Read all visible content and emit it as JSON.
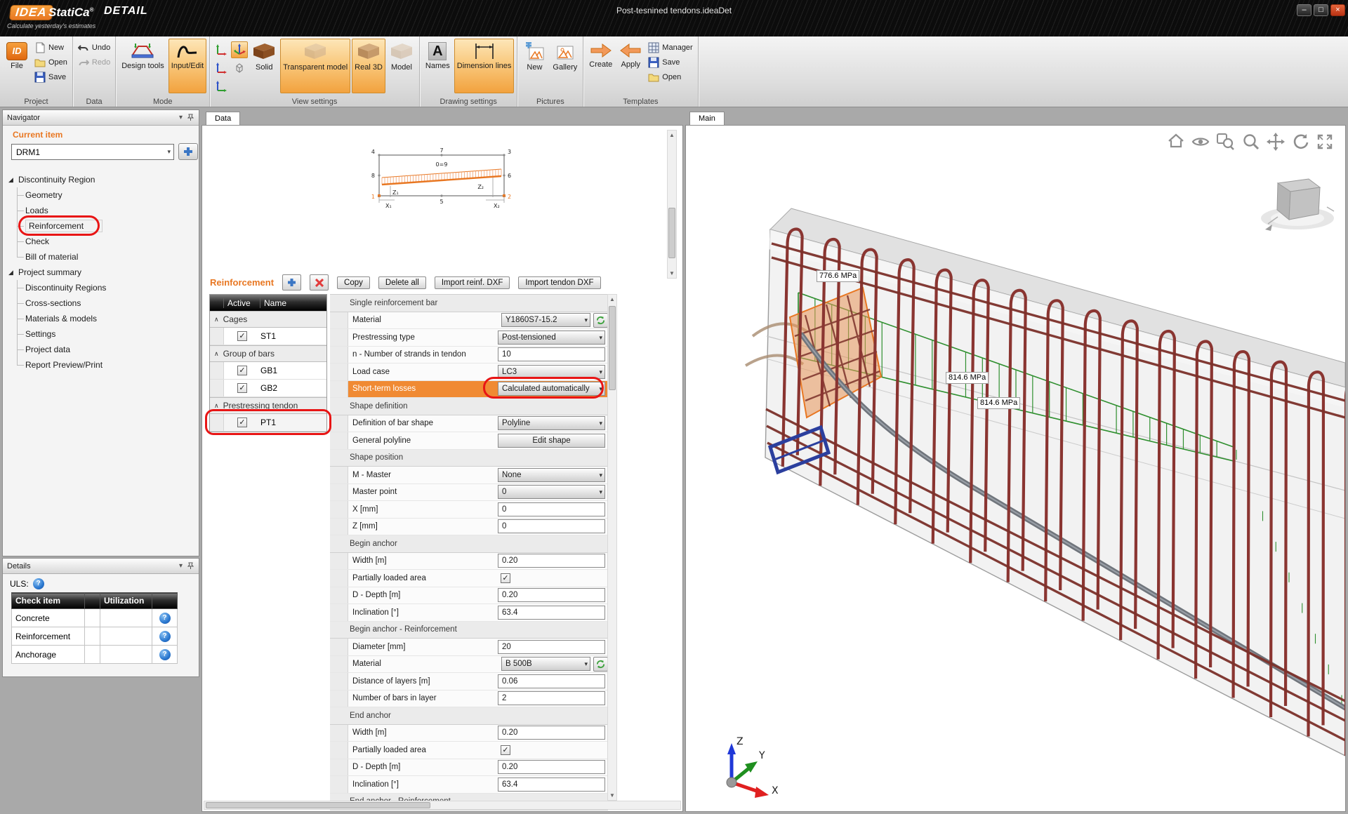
{
  "colors": {
    "accent": "#e87722",
    "annotation": "#e81515",
    "rebar": "#8a3531",
    "rebar_dark": "#6e2a24",
    "tendon": "#70757c",
    "stress_green": "#2f8f2f",
    "selected_row": "#f08a33",
    "concrete": "#e4e4e4"
  },
  "titlebar": {
    "brand": "IDEA",
    "brand2": "StatiCa",
    "reg": "®",
    "product": "DETAIL",
    "tagline": "Calculate yesterday's estimates",
    "document": "Post-tesnined tendons.ideaDet"
  },
  "ribbon": {
    "groups": [
      "Project",
      "Data",
      "Mode",
      "View settings",
      "Drawing settings",
      "Pictures",
      "Templates"
    ],
    "file": "File",
    "new": "New",
    "open": "Open",
    "save": "Save",
    "undo": "Undo",
    "redo": "Redo",
    "design_tools": "Design tools",
    "input_edit": "Input/Edit",
    "solid": "Solid",
    "transparent": "Transparent model",
    "real3d": "Real 3D",
    "model": "Model",
    "names": "Names",
    "dimlines": "Dimension lines",
    "pic_new": "New",
    "gallery": "Gallery",
    "create": "Create",
    "apply": "Apply",
    "manager": "Manager",
    "tsave": "Save",
    "topen": "Open"
  },
  "navigator": {
    "header": "Navigator",
    "current_item_label": "Current item",
    "current_item_value": "DRM1",
    "tree": [
      {
        "label": "Discontinuity Region"
      },
      {
        "label": "Geometry"
      },
      {
        "label": "Loads"
      },
      {
        "label": "Reinforcement"
      },
      {
        "label": "Check"
      },
      {
        "label": "Bill of material"
      },
      {
        "label": "Project summary"
      },
      {
        "label": "Discontinuity Regions"
      },
      {
        "label": "Cross-sections"
      },
      {
        "label": "Materials & models"
      },
      {
        "label": "Settings"
      },
      {
        "label": "Project data"
      },
      {
        "label": "Report Preview/Print"
      }
    ]
  },
  "details": {
    "header": "Details",
    "uls_label": "ULS:",
    "columns": [
      "Check item",
      "",
      "Utilization",
      ""
    ],
    "rows": [
      "Concrete",
      "Reinforcement",
      "Anchorage"
    ]
  },
  "data_panel": {
    "tab": "Data",
    "diagram": {
      "p1": "1",
      "p2": "2",
      "p3": "3",
      "p4": "4",
      "p5": "5",
      "p6": "6",
      "p7": "7",
      "p8": "8",
      "d": "0=9",
      "z1": "Z₁",
      "z2": "Z₂",
      "x1": "X₁",
      "x2": "X₂"
    }
  },
  "reinforcement": {
    "title": "Reinforcement",
    "buttons": {
      "copy": "Copy",
      "delete_all": "Delete all",
      "import_reinf": "Import reinf. DXF",
      "import_tendon": "Import tendon DXF"
    },
    "table": {
      "col_active": "Active",
      "col_name": "Name",
      "groups": [
        {
          "label": "Cages",
          "items": [
            "ST1"
          ]
        },
        {
          "label": "Group of bars",
          "items": [
            "GB1",
            "GB2"
          ]
        },
        {
          "label": "Prestressing tendon",
          "items": [
            "PT1"
          ]
        }
      ]
    }
  },
  "properties": {
    "rows": [
      {
        "t": "sec",
        "label": "Single reinforcement bar"
      },
      {
        "t": "dd",
        "label": "Material",
        "value": "Y1860S7-15.2"
      },
      {
        "t": "dd",
        "label": "Prestressing type",
        "value": "Post-tensioned"
      },
      {
        "t": "in",
        "label": "n - Number of strands in tendon",
        "value": "10"
      },
      {
        "t": "dd",
        "label": "Load case",
        "value": "LC3"
      },
      {
        "t": "dd",
        "label": "Short-term losses",
        "value": "Calculated automatically"
      },
      {
        "t": "sec",
        "label": "Shape definition"
      },
      {
        "t": "dd",
        "label": "Definition of bar shape",
        "value": "Polyline"
      },
      {
        "t": "btn",
        "label": "General polyline",
        "value": "Edit shape"
      },
      {
        "t": "sec",
        "label": "Shape position"
      },
      {
        "t": "dd",
        "label": "M - Master",
        "value": "None"
      },
      {
        "t": "dd",
        "label": "Master point",
        "value": "0"
      },
      {
        "t": "in",
        "label": "X [mm]",
        "value": "0"
      },
      {
        "t": "in",
        "label": "Z [mm]",
        "value": "0"
      },
      {
        "t": "sec",
        "label": "Begin anchor"
      },
      {
        "t": "in",
        "label": "Width [m]",
        "value": "0.20"
      },
      {
        "t": "chk",
        "label": "Partially loaded area",
        "value": "checked"
      },
      {
        "t": "in",
        "label": "D - Depth [m]",
        "value": "0.20"
      },
      {
        "t": "in",
        "label": "Inclination [°]",
        "value": "63.4"
      },
      {
        "t": "sec",
        "label": "Begin anchor - Reinforcement"
      },
      {
        "t": "in",
        "label": "Diameter [mm]",
        "value": "20"
      },
      {
        "t": "dd",
        "label": "Material",
        "value": "B 500B"
      },
      {
        "t": "in",
        "label": "Distance of layers [m]",
        "value": "0.06"
      },
      {
        "t": "in",
        "label": "Number of bars in layer",
        "value": "2"
      },
      {
        "t": "sec",
        "label": "End anchor"
      },
      {
        "t": "in",
        "label": "Width [m]",
        "value": "0.20"
      },
      {
        "t": "chk",
        "label": "Partially loaded area",
        "value": "checked"
      },
      {
        "t": "in",
        "label": "D - Depth [m]",
        "value": "0.20"
      },
      {
        "t": "in",
        "label": "Inclination [°]",
        "value": "63.4"
      },
      {
        "t": "sec",
        "label": "End anchor - Reinforcement"
      }
    ]
  },
  "main_view": {
    "tab": "Main",
    "stress_labels": [
      "776.6 MPa",
      "814.6 MPa",
      "814.6 MPa"
    ],
    "axes": {
      "x": "X",
      "y": "Y",
      "z": "Z"
    }
  }
}
